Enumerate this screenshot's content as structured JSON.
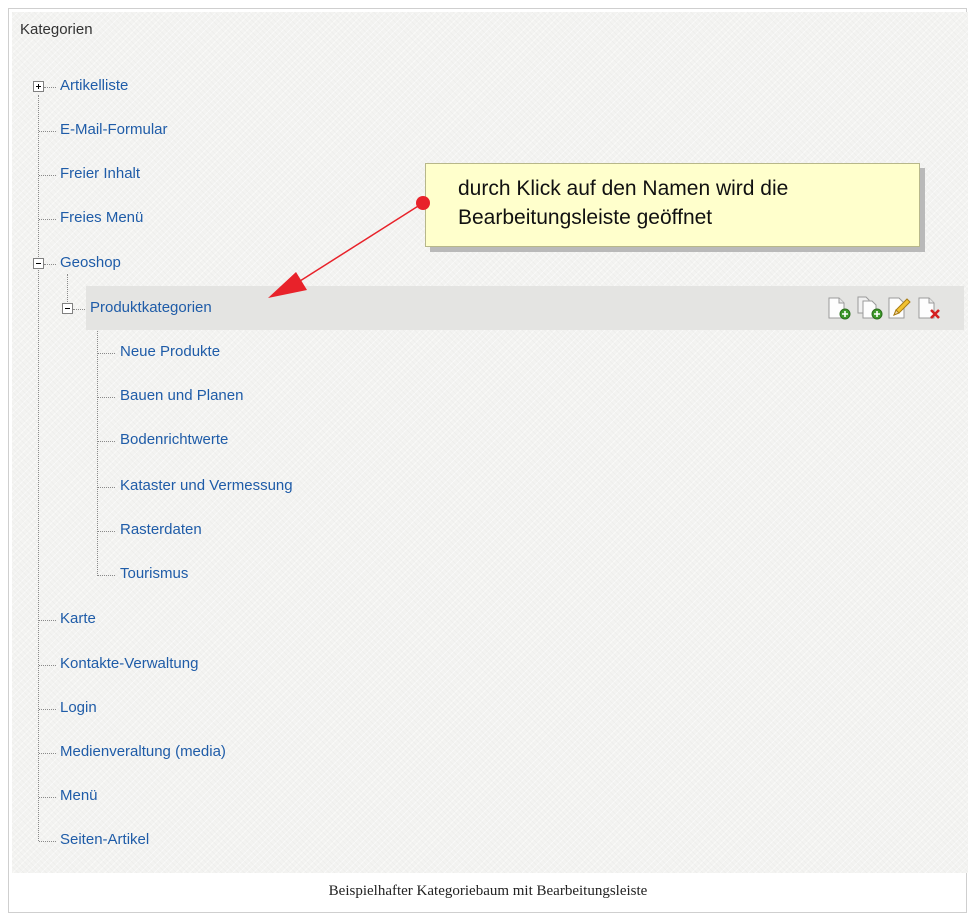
{
  "tree": {
    "heading": "Kategorien",
    "items": [
      {
        "label": "Artikelliste",
        "toggle": "plus"
      },
      {
        "label": "E-Mail-Formular"
      },
      {
        "label": "Freier Inhalt"
      },
      {
        "label": "Freies Menü"
      },
      {
        "label": "Geoshop",
        "toggle": "minus"
      },
      {
        "label": "Produktkategorien",
        "toggle": "minus",
        "selected": true
      },
      {
        "label": "Neue Produkte"
      },
      {
        "label": "Bauen und Planen"
      },
      {
        "label": "Bodenrichtwerte"
      },
      {
        "label": "Kataster und Vermessung"
      },
      {
        "label": "Rasterdaten"
      },
      {
        "label": "Tourismus"
      },
      {
        "label": "Karte"
      },
      {
        "label": "Kontakte-Verwaltung"
      },
      {
        "label": "Login"
      },
      {
        "label": "Medienveraltung (media)"
      },
      {
        "label": "Menü"
      },
      {
        "label": "Seiten-Artikel"
      }
    ]
  },
  "toolbar": {
    "icons": [
      "new-page-icon",
      "copy-page-icon",
      "edit-pencil-icon",
      "delete-page-icon"
    ]
  },
  "callout": {
    "line1": "durch Klick auf den Namen wird die",
    "line2": "Bearbeitungsleiste geöffnet"
  },
  "caption": "Beispielhafter Kategoriebaum mit Bearbeitungsleiste",
  "colors": {
    "link": "#1f5ca8",
    "callout_bg": "#ffffcc",
    "arrow": "#e8222a"
  }
}
